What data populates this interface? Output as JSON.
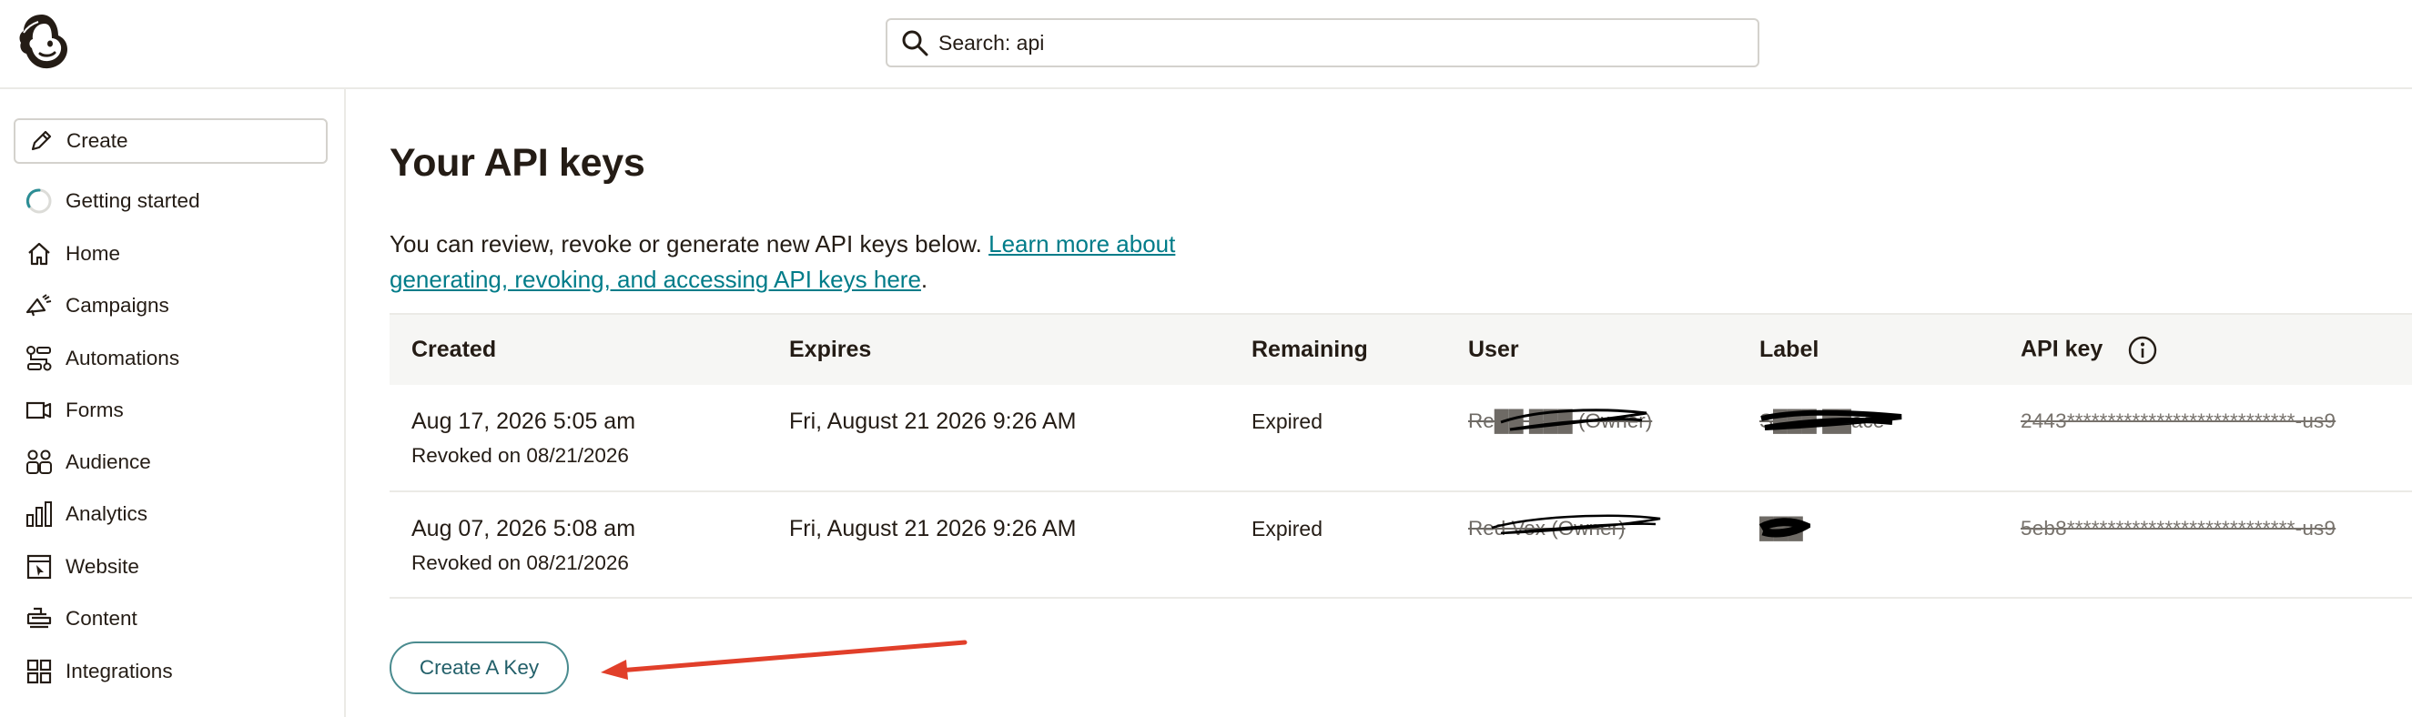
{
  "header": {
    "logo_icon": "mailchimp-freddie-logo-icon",
    "search": {
      "icon": "search-icon",
      "value": "Search: api"
    }
  },
  "sidebar": {
    "create": {
      "label": "Create",
      "icon": "pencil-icon"
    },
    "items": [
      {
        "label": "Getting started",
        "icon": "progress-ring-icon"
      },
      {
        "label": "Home",
        "icon": "home-icon"
      },
      {
        "label": "Campaigns",
        "icon": "megaphone-icon"
      },
      {
        "label": "Automations",
        "icon": "automations-icon"
      },
      {
        "label": "Forms",
        "icon": "forms-icon"
      },
      {
        "label": "Audience",
        "icon": "audience-icon"
      },
      {
        "label": "Analytics",
        "icon": "bar-chart-icon"
      },
      {
        "label": "Website",
        "icon": "website-icon"
      },
      {
        "label": "Content",
        "icon": "content-icon"
      },
      {
        "label": "Integrations",
        "icon": "grid-icon"
      }
    ]
  },
  "main": {
    "title": "Your API keys",
    "intro_text": "You can review, revoke or generate new API keys below. ",
    "intro_link": "Learn more about generating, revoking, and accessing API keys here",
    "intro_end": ".",
    "table": {
      "columns": [
        "Created",
        "Expires",
        "Remaining",
        "User",
        "Label",
        "API key"
      ],
      "rows": [
        {
          "created": "Aug 17, 2026 5:05 am",
          "revoked": "Revoked on 08/21/2026",
          "expires": "Fri, August 21 2026 9:26 AM",
          "remaining": "Expired",
          "user": "Re██ ███ (Owner)",
          "label": "S███ ██ace",
          "api_key": "2443****************************-us9"
        },
        {
          "created": "Aug 07, 2026 5:08 am",
          "revoked": "Revoked on 08/21/2026",
          "expires": "Fri, August 21 2026 9:26 AM",
          "remaining": "Expired",
          "user": "Red Vox (Owner)",
          "label": "███",
          "api_key": "5eb8****************************-us9"
        }
      ]
    },
    "create_key_label": "Create A Key"
  },
  "colors": {
    "link": "#007c89",
    "button_border": "#4a8b8f",
    "annotation_arrow": "#e13f2a",
    "table_header_bg": "#f6f6f4"
  }
}
